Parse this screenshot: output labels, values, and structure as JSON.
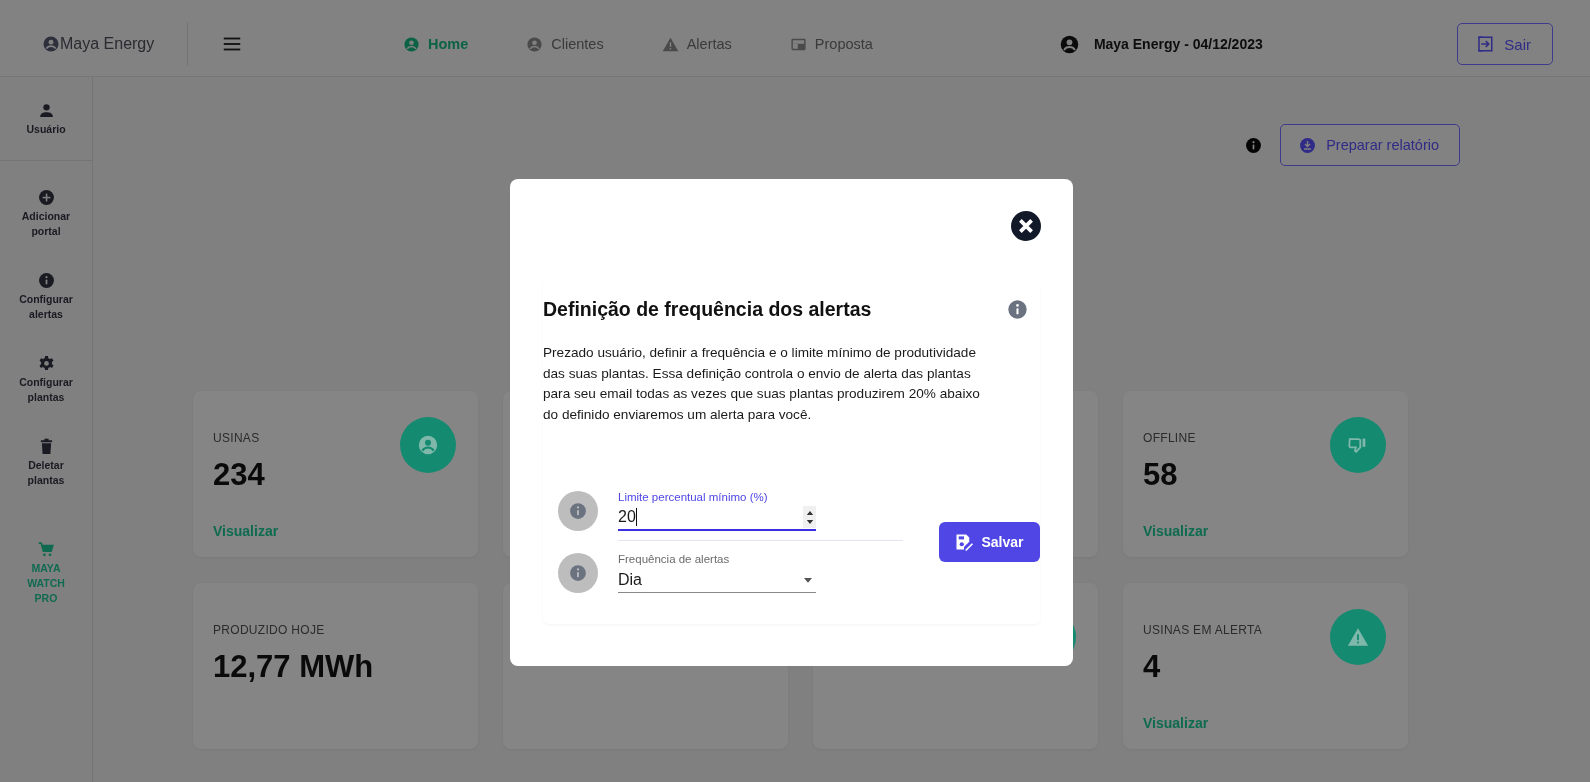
{
  "topbar": {
    "brand": "Maya Energy",
    "nav": [
      {
        "label": "Home",
        "selected": true
      },
      {
        "label": "Clientes",
        "selected": false
      },
      {
        "label": "Alertas",
        "selected": false
      },
      {
        "label": "Proposta",
        "selected": false
      }
    ],
    "account": "Maya Energy - 04/12/2023",
    "logout": "Sair"
  },
  "sidebar": {
    "sections": [
      {
        "items": [
          {
            "label": "Usuário",
            "highlighted": false
          }
        ]
      },
      {
        "items": [
          {
            "label": "Adicionar portal",
            "highlighted": false
          },
          {
            "label": "Configurar alertas",
            "highlighted": false
          },
          {
            "label": "Configurar plantas",
            "highlighted": false
          },
          {
            "label": "Deletar plantas",
            "highlighted": false
          },
          {
            "label": "MAYA WATCH PRO",
            "highlighted": true
          }
        ]
      }
    ]
  },
  "main": {
    "report_button": "Preparar relatório",
    "cards": [
      {
        "label": "USINAS",
        "value": "234",
        "link": "Visualizar"
      },
      {
        "label": "OFFLINE",
        "value": "58",
        "link": "Visualizar"
      },
      {
        "label": "PRODUZIDO HOJE",
        "value": "12,77 MWh"
      },
      {
        "label": "USINAS EM ALERTA",
        "value": "4",
        "link": "Visualizar"
      }
    ]
  },
  "modal": {
    "title": "Definição de frequência dos alertas",
    "description": "Prezado usuário, definir a frequência e o limite mínimo de produtividade das suas plantas. Essa definição controla o envio de alerta das plantas para seu email todas as vezes que suas plantas produzirem 20% abaixo do definido enviaremos um alerta para você.",
    "fields": [
      {
        "kind": "number",
        "label": "Limite percentual mínimo (%)",
        "value": "20",
        "focused": true
      },
      {
        "kind": "select",
        "label": "Frequência de alertas",
        "value": "Dia",
        "focused": false
      }
    ],
    "save": "Salvar"
  }
}
